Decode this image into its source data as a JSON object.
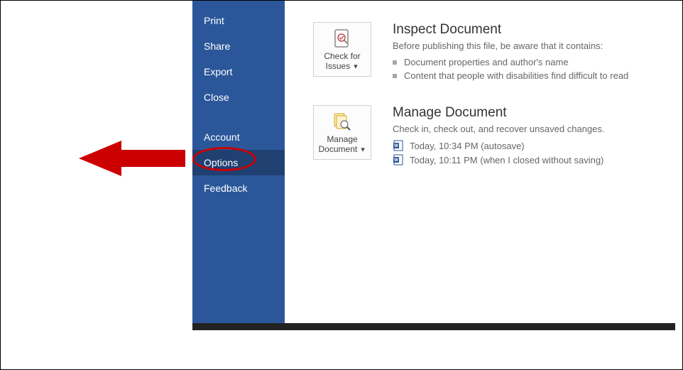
{
  "sidebar": {
    "items": [
      {
        "label": "Print"
      },
      {
        "label": "Share"
      },
      {
        "label": "Export"
      },
      {
        "label": "Close"
      },
      {
        "label": "Account"
      },
      {
        "label": "Options"
      },
      {
        "label": "Feedback"
      }
    ]
  },
  "inspect": {
    "button_line1": "Check for",
    "button_line2": "Issues",
    "title": "Inspect Document",
    "subtitle": "Before publishing this file, be aware that it contains:",
    "bullets": [
      "Document properties and author's name",
      "Content that people with disabilities find difficult to read"
    ]
  },
  "manage": {
    "button_line1": "Manage",
    "button_line2": "Document",
    "title": "Manage Document",
    "subtitle": "Check in, check out, and recover unsaved changes.",
    "versions": [
      "Today, 10:34 PM (autosave)",
      "Today, 10:11 PM (when I closed without saving)"
    ]
  }
}
